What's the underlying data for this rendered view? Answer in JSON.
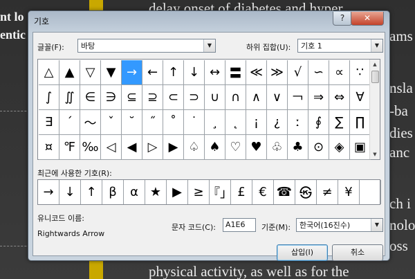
{
  "background": {
    "left_lines": [
      "nt lo",
      "entic"
    ],
    "right_lines": [
      "delay onset of diabetes and hyper",
      "ams",
      "nsla",
      "-ba",
      "dies",
      "anc",
      "ch i",
      "nolo",
      "oss",
      "physical activity, as well as for the"
    ]
  },
  "dialog": {
    "title": "기호",
    "help_label": "?",
    "close_label": "✕",
    "font_label": "글꼴(F):",
    "font_value": "바탕",
    "subset_label": "하위 집합(U):",
    "subset_value": "기호 1",
    "symbols": [
      "△",
      "▲",
      "▽",
      "▼",
      "→",
      "←",
      "↑",
      "↓",
      "↔",
      "〓",
      "≪",
      "≫",
      "√",
      "∽",
      "∝",
      "∵",
      "∫",
      "∬",
      "∈",
      "∋",
      "⊆",
      "⊇",
      "⊂",
      "⊃",
      "∪",
      "∩",
      "∧",
      "∨",
      "￢",
      "⇒",
      "⇔",
      "∀",
      "∃",
      "´",
      "～",
      "ˇ",
      "˘",
      "˝",
      "˚",
      "˙",
      "¸",
      "˛",
      "¡",
      "¿",
      "ː",
      "∮",
      "∑",
      "∏",
      "¤",
      "℉",
      "‰",
      "◁",
      "◀",
      "▷",
      "▶",
      "♤",
      "♠",
      "♡",
      "♥",
      "♧",
      "♣",
      "⊙",
      "◈",
      "▣"
    ],
    "selected_index": 4,
    "recent_label": "최근에 사용한 기호(R):",
    "recent_symbols": [
      "→",
      "↓",
      "↑",
      "β",
      "α",
      "★",
      "▶",
      "≥",
      "『」",
      "£",
      "€",
      "☎",
      "㉿",
      "≠",
      "¥",
      ""
    ],
    "unicode_name_label": "유니코드 이름:",
    "unicode_name_value": "Rightwards Arrow",
    "char_code_label": "문자 코드(C):",
    "char_code_value": "A1E6",
    "from_label": "기준(M):",
    "from_value": "한국어(16진수)",
    "insert_label": "삽입(I)",
    "cancel_label": "취소"
  }
}
